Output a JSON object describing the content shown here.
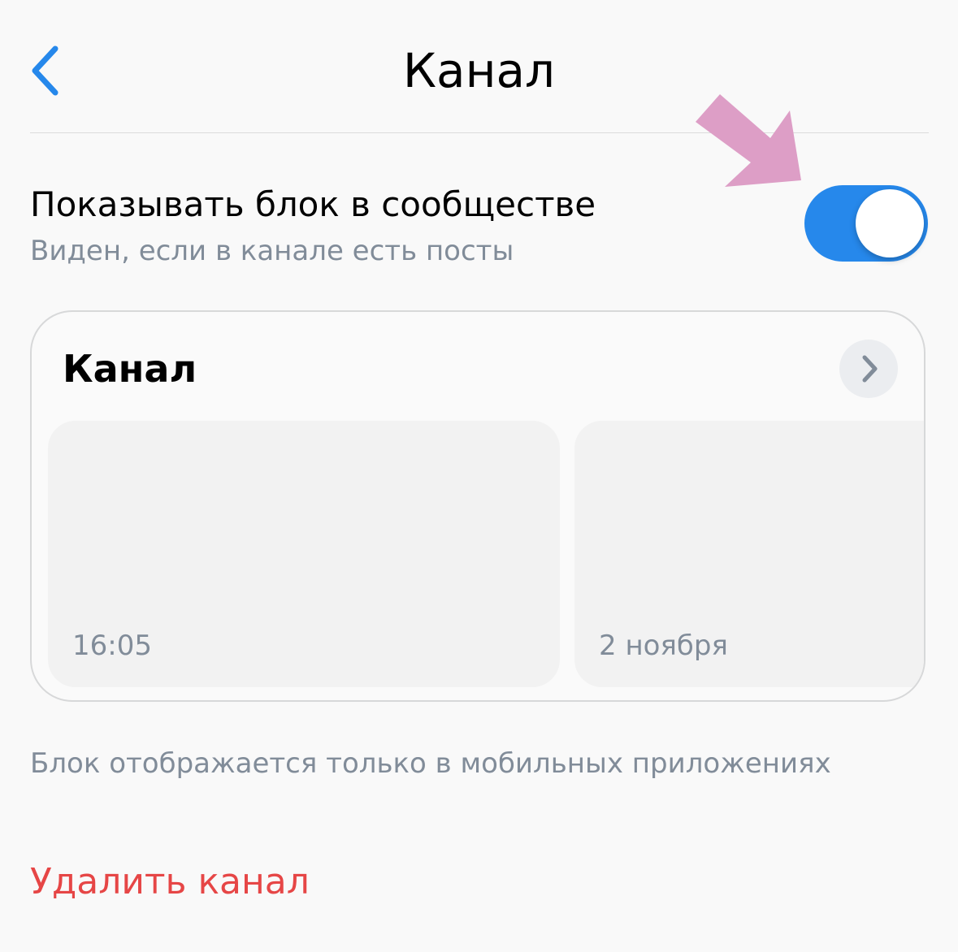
{
  "header": {
    "title": "Канал",
    "back_icon": "chevron-left-icon"
  },
  "setting": {
    "label": "Показывать блок в сообществе",
    "sublabel": "Виден, если в канале есть посты",
    "toggle_on": true
  },
  "preview": {
    "title": "Канал",
    "open_icon": "chevron-right-icon",
    "posts": [
      {
        "date": "16:05"
      },
      {
        "date": "2 ноября"
      }
    ]
  },
  "footnote": "Блок отображается только в мобильных приложениях",
  "delete_label": "Удалить канал",
  "colors": {
    "accent": "#2688eb",
    "destructive": "#e64646",
    "secondary_text": "#818c99",
    "annotation_arrow": "#dd9ec6"
  }
}
